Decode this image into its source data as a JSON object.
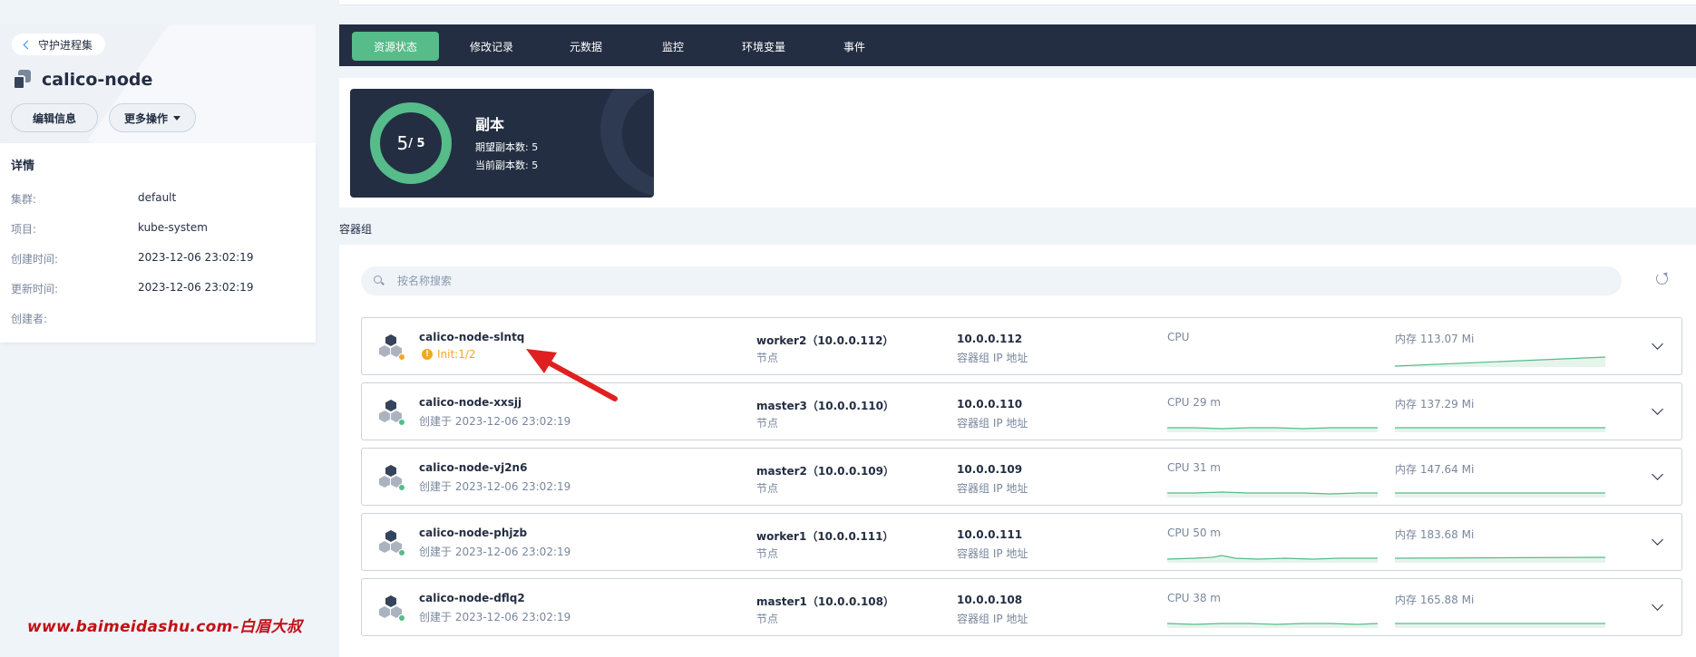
{
  "back_label": "守护进程集",
  "title": "calico-node",
  "actions": {
    "edit": "编辑信息",
    "more": "更多操作"
  },
  "details": {
    "heading": "详情",
    "rows": [
      {
        "label": "集群:",
        "value": "default"
      },
      {
        "label": "项目:",
        "value": "kube-system"
      },
      {
        "label": "创建时间:",
        "value": "2023-12-06 23:02:19"
      },
      {
        "label": "更新时间:",
        "value": "2023-12-06 23:02:19"
      },
      {
        "label": "创建者:",
        "value": ""
      }
    ]
  },
  "tabs": [
    "资源状态",
    "修改记录",
    "元数据",
    "监控",
    "环境变量",
    "事件"
  ],
  "replica": {
    "current": "5",
    "desired": "/ 5",
    "title": "副本",
    "desired_line": "期望副本数: 5",
    "current_line": "当前副本数: 5"
  },
  "pods_section_label": "容器组",
  "search_placeholder": "按名称搜索",
  "node_label": "节点",
  "ip_label": "容器组 IP 地址",
  "pods": [
    {
      "name": "calico-node-slntq",
      "sub": "Init:1/2",
      "status": "warning",
      "node": "worker2（10.0.0.112）",
      "ip": "10.0.0.112",
      "cpu": "CPU",
      "mem": "内存 113.07 Mi"
    },
    {
      "name": "calico-node-xxsjj",
      "sub": "创建于 2023-12-06 23:02:19",
      "status": "running",
      "node": "master3（10.0.0.110）",
      "ip": "10.0.0.110",
      "cpu": "CPU 29 m",
      "mem": "内存 137.29 Mi"
    },
    {
      "name": "calico-node-vj2n6",
      "sub": "创建于 2023-12-06 23:02:19",
      "status": "running",
      "node": "master2（10.0.0.109）",
      "ip": "10.0.0.109",
      "cpu": "CPU 31 m",
      "mem": "内存 147.64 Mi"
    },
    {
      "name": "calico-node-phjzb",
      "sub": "创建于 2023-12-06 23:02:19",
      "status": "running",
      "node": "worker1（10.0.0.111）",
      "ip": "10.0.0.111",
      "cpu": "CPU 50 m",
      "mem": "内存 183.68 Mi"
    },
    {
      "name": "calico-node-dflq2",
      "sub": "创建于 2023-12-06 23:02:19",
      "status": "running",
      "node": "master1（10.0.0.108）",
      "ip": "10.0.0.108",
      "cpu": "CPU 38 m",
      "mem": "内存 165.88 Mi"
    }
  ],
  "watermark": "www.baimeidashu.com-白眉大叔",
  "colors": {
    "accent": "#55bc8a",
    "dark": "#242e42",
    "warning": "#f5a623"
  }
}
